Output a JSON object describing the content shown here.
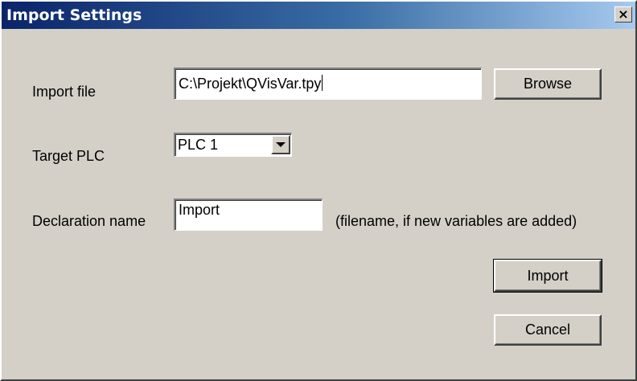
{
  "window": {
    "title": "Import Settings",
    "close_glyph": "×"
  },
  "form": {
    "import_file": {
      "label": "Import file",
      "value": "C:\\Projekt\\QVisVar.tpy",
      "browse_label": "Browse"
    },
    "target_plc": {
      "label": "Target PLC",
      "selected": "PLC 1",
      "arrow_icon": "chevron-down-icon"
    },
    "declaration_name": {
      "label": "Declaration name",
      "value": "Import",
      "hint": "(filename, if new variables are added)"
    }
  },
  "actions": {
    "import_label": "Import",
    "cancel_label": "Cancel"
  },
  "colors": {
    "titlebar_start": "#0a246a",
    "titlebar_end": "#a6caf0",
    "face": "#d4d0c8"
  }
}
